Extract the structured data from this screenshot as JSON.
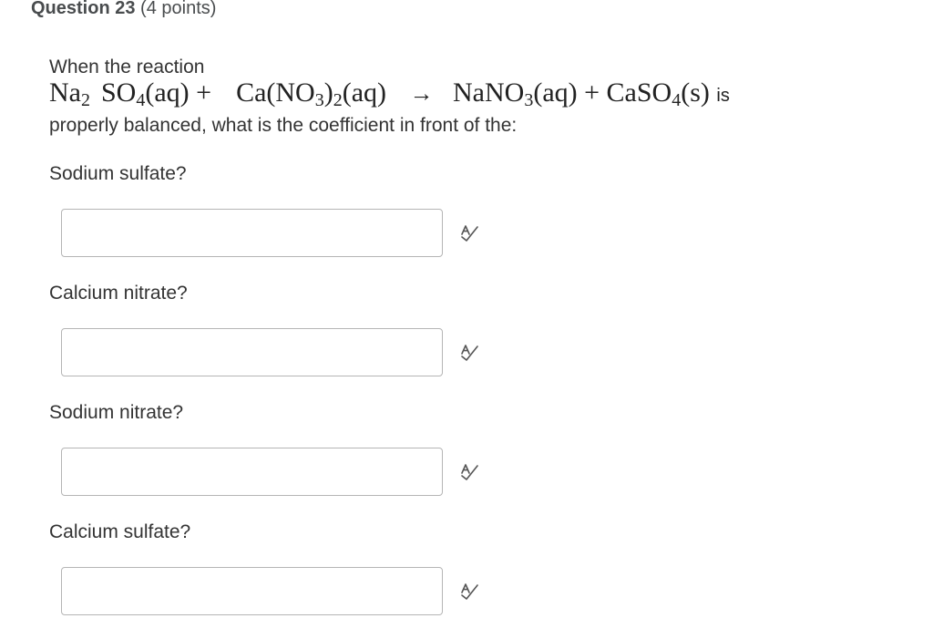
{
  "question": {
    "title": "Question 23",
    "points": "(4 points)",
    "intro": "When the reaction",
    "equation": {
      "r1_a": "Na",
      "r1_s1": "2",
      "r1_b": "SO",
      "r1_s2": "4",
      "r1_c": "(aq) +",
      "r2_a": "Ca(NO",
      "r2_s1": "3",
      "r2_b": ")",
      "r2_s2": "2",
      "r2_c": "(aq)",
      "arrow": "→",
      "p1_a": "NaNO",
      "p1_s1": "3",
      "p1_b": "(aq) +",
      "p2_a": "CaSO",
      "p2_s1": "4",
      "p2_b": "(s)",
      "tail": "is"
    },
    "continuation": "properly balanced, what is the coefficient in front of the:"
  },
  "parts": [
    {
      "label": "Sodium sulfate?",
      "value": "",
      "icon": "spell-check-icon"
    },
    {
      "label": "Calcium nitrate?",
      "value": "",
      "icon": "spell-check-icon"
    },
    {
      "label": "Sodium nitrate?",
      "value": "",
      "icon": "spell-check-icon"
    },
    {
      "label": "Calcium sulfate?",
      "value": "",
      "icon": "spell-check-icon"
    }
  ]
}
